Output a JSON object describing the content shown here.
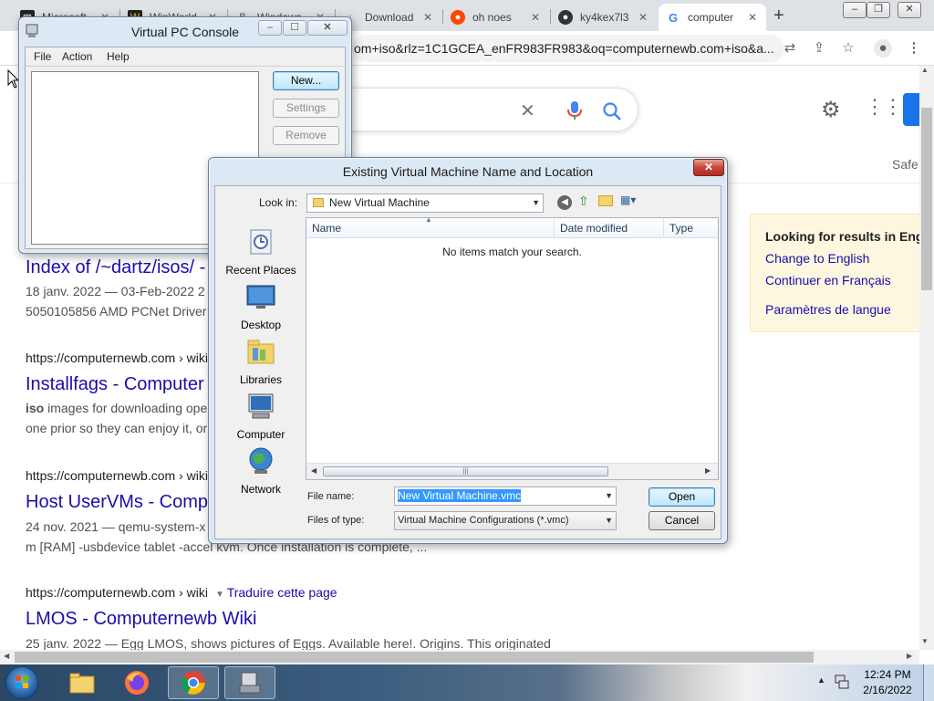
{
  "browser": {
    "tabs": [
      {
        "title": "Microsoft",
        "favicon": "microsoft-favicon"
      },
      {
        "title": "WinWorld",
        "favicon": "winworld-favicon"
      },
      {
        "title": "Windows",
        "favicon": "windows-favicon"
      },
      {
        "title": "Download",
        "favicon": "download-favicon"
      },
      {
        "title": "oh noes",
        "favicon": "reddit-favicon"
      },
      {
        "title": "ky4kex7l3",
        "favicon": "github-favicon"
      },
      {
        "title": "computer",
        "favicon": "google-favicon"
      }
    ],
    "url": "om+iso&rlz=1C1GCEA_enFR983FR983&oq=computernewb.com+iso&a..."
  },
  "google": {
    "safe_label": "Safe",
    "results": [
      {
        "title": "Index of /~dartz/isos/ -",
        "snippet1": "18 janv. 2022 — 03-Feb-2022 2",
        "snippet2": "5050105856 AMD PCNet Driver"
      },
      {
        "url": "https://computernewb.com › wiki",
        "title": "Installfags - Computer",
        "snippet1_bold": "iso",
        "snippet1": " images for downloading ope",
        "snippet2": "one prior so they can enjoy it, or"
      },
      {
        "url": "https://computernewb.com › wiki",
        "title": "Host UserVMs - Comp",
        "snippet1": "24 nov. 2021 — qemu-system-x",
        "snippet2": "m [RAM] -usbdevice tablet -accel kvm. Once installation is complete, ..."
      },
      {
        "url": "https://computernewb.com › wiki",
        "translate": "Traduire cette page",
        "title": "LMOS - Computernewb Wiki",
        "snippet1": "25 janv. 2022 — Egg LMOS, shows pictures of Eggs. Available here!. Origins. This originated"
      }
    ],
    "lang_box": {
      "heading": "Looking for results in Engli",
      "change": "Change to English",
      "continue": "Continuer en Français",
      "settings": "Paramètres de langue"
    }
  },
  "vpc_console": {
    "title": "Virtual PC Console",
    "menu": [
      "File",
      "Action",
      "Help"
    ],
    "buttons": {
      "new": "New...",
      "settings": "Settings",
      "remove": "Remove"
    }
  },
  "dialog": {
    "title": "Existing Virtual Machine Name and Location",
    "look_in_label": "Look in:",
    "look_in_value": "New Virtual Machine",
    "places": [
      "Recent Places",
      "Desktop",
      "Libraries",
      "Computer",
      "Network"
    ],
    "columns": [
      "Name",
      "Date modified",
      "Type"
    ],
    "empty_message": "No items match your search.",
    "file_name_label": "File name:",
    "file_name_value": "New Virtual Machine.vmc",
    "files_of_type_label": "Files of type:",
    "files_of_type_value": "Virtual Machine Configurations (*.vmc)",
    "open_label": "Open",
    "cancel_label": "Cancel"
  },
  "taskbar": {
    "clock_time": "12:24 PM",
    "clock_date": "2/16/2022"
  },
  "colors": {
    "link": "#1a0dab",
    "dialog_frame": "#dde8f5",
    "close_red": "#c9443a",
    "selection": "#3399ff"
  }
}
